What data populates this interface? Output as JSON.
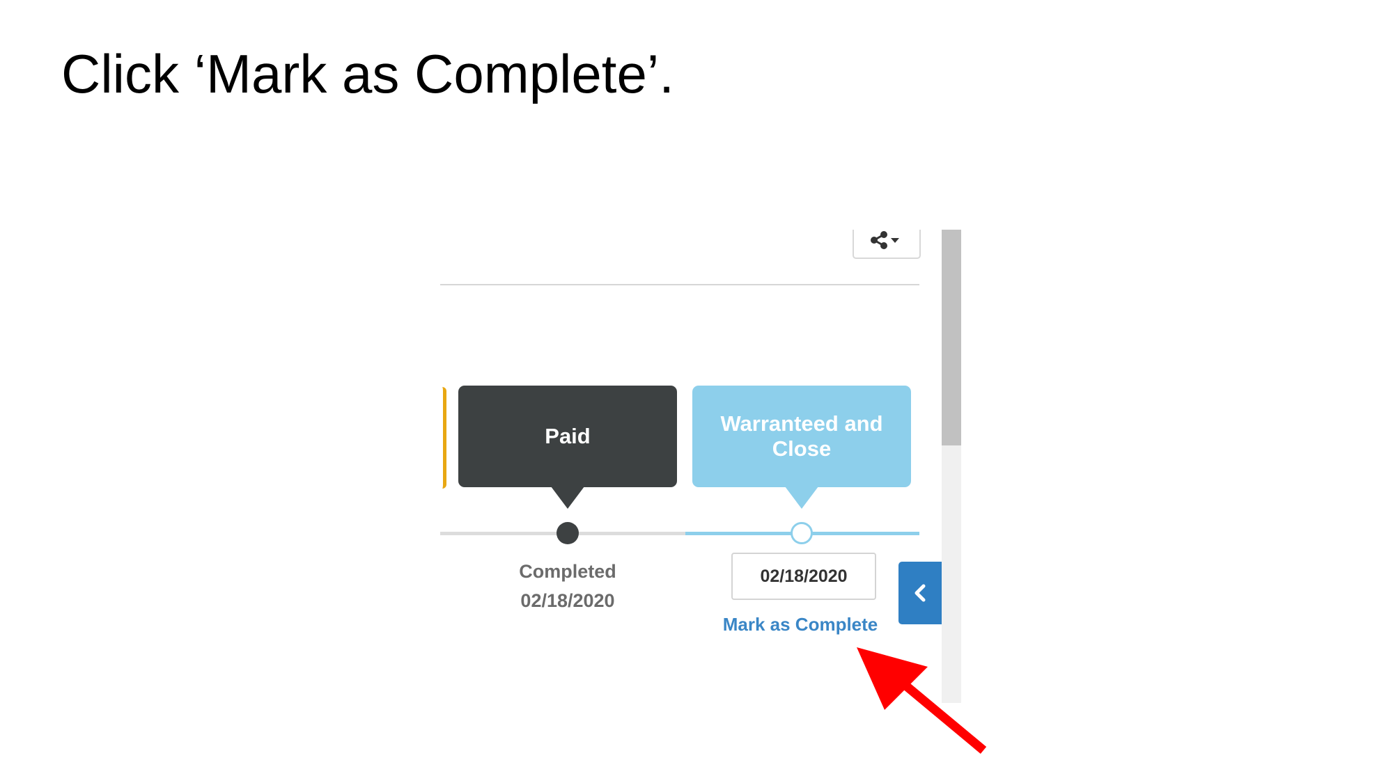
{
  "slide": {
    "instruction": "Click ‘Mark as Complete’."
  },
  "toolbar": {
    "share_icon": "share-icon",
    "dropdown_icon": "caret-down-icon"
  },
  "stages": {
    "paid": {
      "label": "Paid",
      "status_label": "Completed",
      "status_date": "02/18/2020",
      "color": "#3d4142"
    },
    "warranty": {
      "label": "Warranteed and Close",
      "date_value": "02/18/2020",
      "action_label": "Mark as Complete",
      "color": "#8dcfeb"
    },
    "previous_stage_accent": "#e8a712"
  },
  "side_panel": {
    "collapse_icon": "chevron-left-icon",
    "color": "#2f7fc3"
  },
  "annotation": {
    "arrow_color": "#ff0000"
  }
}
